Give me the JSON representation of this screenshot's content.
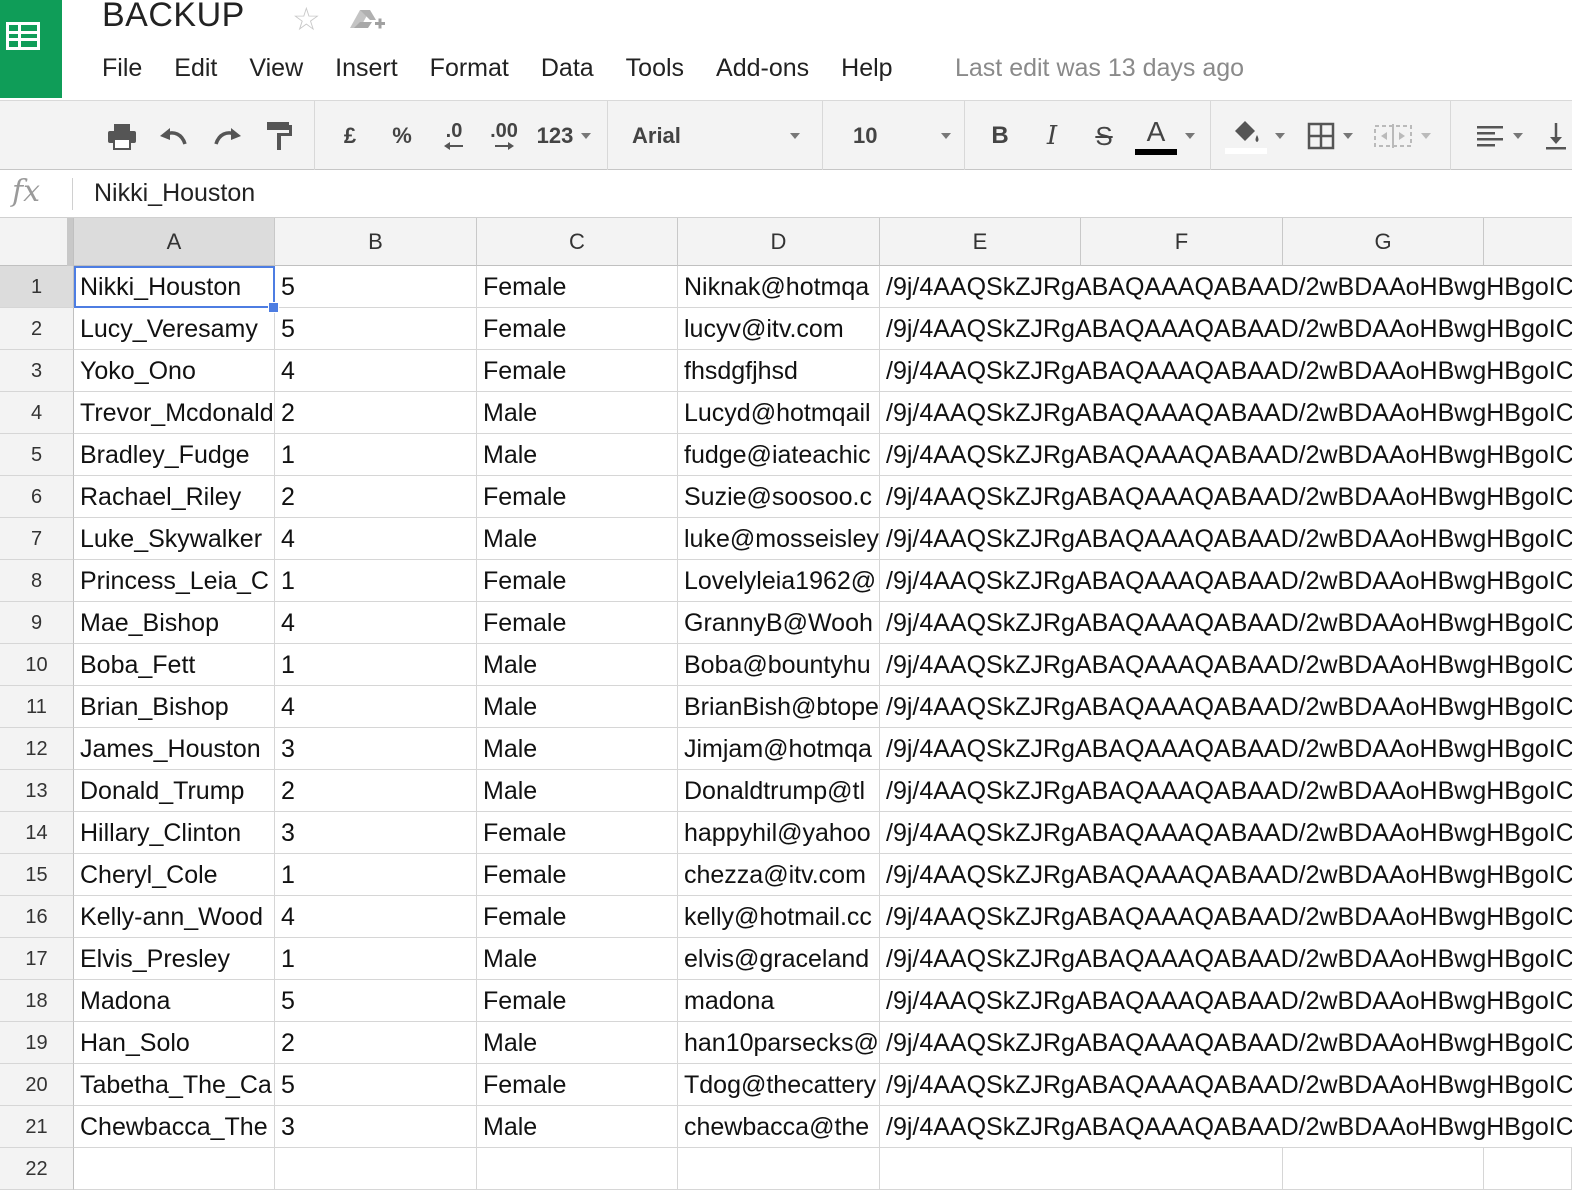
{
  "document": {
    "title": "BACKUP",
    "last_edit": "Last edit was 13 days ago"
  },
  "menu": [
    "File",
    "Edit",
    "View",
    "Insert",
    "Format",
    "Data",
    "Tools",
    "Add-ons",
    "Help"
  ],
  "toolbar": {
    "currency_label": "£",
    "percent_label": "%",
    "decrease_decimal_label": ".0",
    "increase_decimal_label": ".00",
    "number_format_label": "123",
    "font": "Arial",
    "font_size": "10",
    "bold_label": "B",
    "italic_label": "I",
    "strike_label": "S",
    "text_color_label": "A",
    "icons": [
      "print-icon",
      "undo-icon",
      "redo-icon",
      "paint-format-icon",
      "fill-color-icon",
      "borders-icon",
      "merge-cells-icon",
      "align-left-icon",
      "vertical-align-icon"
    ]
  },
  "formula_bar": {
    "fx_label": "fx",
    "value": "Nikki_Houston"
  },
  "sheet": {
    "active_cell": "A1",
    "columns": [
      "A",
      "B",
      "C",
      "D",
      "E",
      "F",
      "G",
      ""
    ],
    "rows": [
      {
        "n": "1",
        "a": "Nikki_Houston",
        "b": "5",
        "c": "Female",
        "d": "Niknak@hotmqa",
        "e": "/9j/4AAQSkZJRgABAQAAAQABAAD/2wBDAAoHBwgHBgoIC"
      },
      {
        "n": "2",
        "a": "Lucy_Veresamy",
        "b": "5",
        "c": "Female",
        "d": "lucyv@itv.com",
        "e": "/9j/4AAQSkZJRgABAQAAAQABAAD/2wBDAAoHBwgHBgoIC"
      },
      {
        "n": "3",
        "a": "Yoko_Ono",
        "b": "4",
        "c": "Female",
        "d": "fhsdgfjhsd",
        "e": "/9j/4AAQSkZJRgABAQAAAQABAAD/2wBDAAoHBwgHBgoIC"
      },
      {
        "n": "4",
        "a": "Trevor_Mcdonald",
        "b": "2",
        "c": "Male",
        "d": "Lucyd@hotmqail",
        "e": "/9j/4AAQSkZJRgABAQAAAQABAAD/2wBDAAoHBwgHBgoIC"
      },
      {
        "n": "5",
        "a": "Bradley_Fudge",
        "b": "1",
        "c": "Male",
        "d": "fudge@iateachic",
        "e": "/9j/4AAQSkZJRgABAQAAAQABAAD/2wBDAAoHBwgHBgoIC"
      },
      {
        "n": "6",
        "a": "Rachael_Riley",
        "b": "2",
        "c": "Female",
        "d": "Suzie@soosoo.c",
        "e": "/9j/4AAQSkZJRgABAQAAAQABAAD/2wBDAAoHBwgHBgoIC"
      },
      {
        "n": "7",
        "a": "Luke_Skywalker",
        "b": "4",
        "c": "Male",
        "d": "luke@mosseisley",
        "e": "/9j/4AAQSkZJRgABAQAAAQABAAD/2wBDAAoHBwgHBgoIC"
      },
      {
        "n": "8",
        "a": "Princess_Leia_C",
        "b": "1",
        "c": "Female",
        "d": "Lovelyleia1962@",
        "e": "/9j/4AAQSkZJRgABAQAAAQABAAD/2wBDAAoHBwgHBgoIC"
      },
      {
        "n": "9",
        "a": "Mae_Bishop",
        "b": "4",
        "c": "Female",
        "d": "GrannyB@Wooh",
        "e": "/9j/4AAQSkZJRgABAQAAAQABAAD/2wBDAAoHBwgHBgoIC"
      },
      {
        "n": "10",
        "a": "Boba_Fett",
        "b": "1",
        "c": "Male",
        "d": "Boba@bountyhu",
        "e": "/9j/4AAQSkZJRgABAQAAAQABAAD/2wBDAAoHBwgHBgoIC"
      },
      {
        "n": "11",
        "a": "Brian_Bishop",
        "b": "4",
        "c": "Male",
        "d": "BrianBish@btope",
        "e": "/9j/4AAQSkZJRgABAQAAAQABAAD/2wBDAAoHBwgHBgoIC"
      },
      {
        "n": "12",
        "a": "James_Houston",
        "b": "3",
        "c": "Male",
        "d": "Jimjam@hotmqa",
        "e": "/9j/4AAQSkZJRgABAQAAAQABAAD/2wBDAAoHBwgHBgoIC"
      },
      {
        "n": "13",
        "a": "Donald_Trump",
        "b": "2",
        "c": "Male",
        "d": "Donaldtrump@tl",
        "e": "/9j/4AAQSkZJRgABAQAAAQABAAD/2wBDAAoHBwgHBgoIC"
      },
      {
        "n": "14",
        "a": "Hillary_Clinton",
        "b": "3",
        "c": "Female",
        "d": "happyhil@yahoo",
        "e": "/9j/4AAQSkZJRgABAQAAAQABAAD/2wBDAAoHBwgHBgoIC"
      },
      {
        "n": "15",
        "a": "Cheryl_Cole",
        "b": "1",
        "c": "Female",
        "d": "chezza@itv.com",
        "e": "/9j/4AAQSkZJRgABAQAAAQABAAD/2wBDAAoHBwgHBgoIC"
      },
      {
        "n": "16",
        "a": "Kelly-ann_Wood",
        "b": "4",
        "c": "Female",
        "d": "kelly@hotmail.cc",
        "e": "/9j/4AAQSkZJRgABAQAAAQABAAD/2wBDAAoHBwgHBgoIC"
      },
      {
        "n": "17",
        "a": "Elvis_Presley",
        "b": "1",
        "c": "Male",
        "d": "elvis@graceland",
        "e": "/9j/4AAQSkZJRgABAQAAAQABAAD/2wBDAAoHBwgHBgoIC"
      },
      {
        "n": "18",
        "a": "Madona",
        "b": "5",
        "c": "Female",
        "d": "madona",
        "e": "/9j/4AAQSkZJRgABAQAAAQABAAD/2wBDAAoHBwgHBgoIC"
      },
      {
        "n": "19",
        "a": "Han_Solo",
        "b": "2",
        "c": "Male",
        "d": "han10parsecks@",
        "e": "/9j/4AAQSkZJRgABAQAAAQABAAD/2wBDAAoHBwgHBgoIC"
      },
      {
        "n": "20",
        "a": "Tabetha_The_Ca",
        "b": "5",
        "c": "Female",
        "d": "Tdog@thecattery",
        "e": "/9j/4AAQSkZJRgABAQAAAQABAAD/2wBDAAoHBwgHBgoIC"
      },
      {
        "n": "21",
        "a": "Chewbacca_The",
        "b": "3",
        "c": "Male",
        "d": "chewbacca@the",
        "e": "/9j/4AAQSkZJRgABAQAAAQABAAD/2wBDAAoHBwgHBgoIC"
      },
      {
        "n": "22",
        "a": "",
        "b": "",
        "c": "",
        "d": "",
        "e": ""
      }
    ]
  },
  "colors": {
    "brand": "#0f9d58",
    "selection": "#4d7de2",
    "toolbar_bg": "#f3f3f3"
  }
}
